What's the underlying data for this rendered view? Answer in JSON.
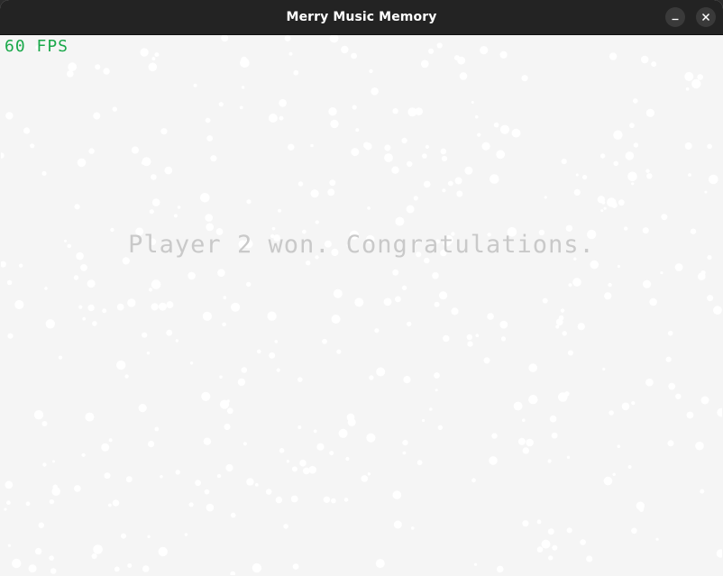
{
  "window": {
    "title": "Merry Music Memory"
  },
  "controls": {
    "minimize_icon": "minimize-icon",
    "close_icon": "close-icon"
  },
  "game": {
    "fps_text": "60 FPS",
    "message": "Player 2 won. Congratulations."
  },
  "colors": {
    "titlebar": "#232323",
    "background": "#f5f5f5",
    "snow": "#ffffff",
    "fps": "#1aa84a",
    "message": "#c9c9c9"
  }
}
